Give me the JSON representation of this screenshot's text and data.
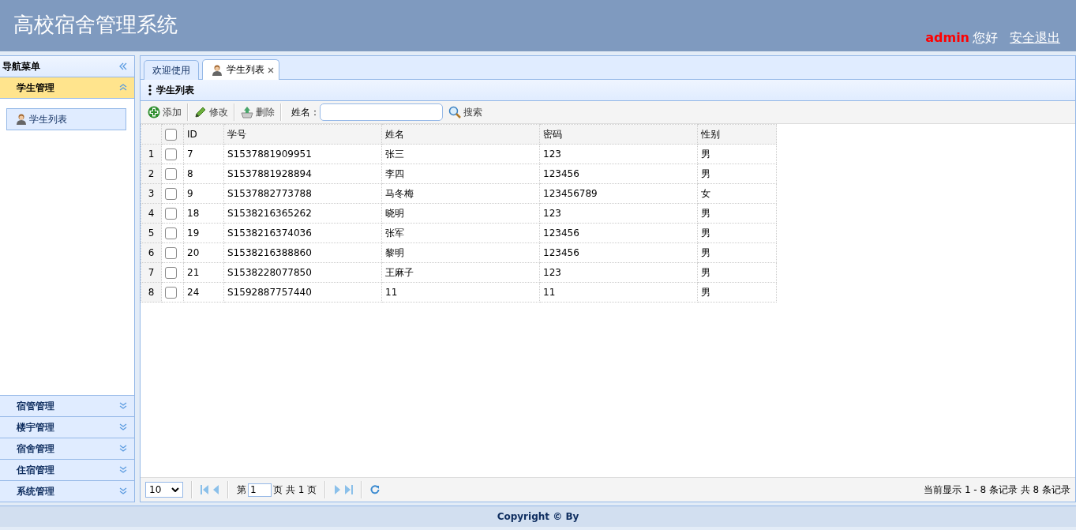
{
  "header": {
    "title": "高校宿舍管理系统",
    "user": "admin",
    "greeting": "您好",
    "logout": "安全退出"
  },
  "nav": {
    "title": "导航菜单",
    "sections": [
      {
        "label": "学生管理",
        "expanded": true,
        "items": [
          {
            "label": "学生列表",
            "selected": true
          }
        ]
      },
      {
        "label": "宿管管理",
        "expanded": false
      },
      {
        "label": "楼宇管理",
        "expanded": false
      },
      {
        "label": "宿舍管理",
        "expanded": false
      },
      {
        "label": "住宿管理",
        "expanded": false
      },
      {
        "label": "系统管理",
        "expanded": false
      }
    ]
  },
  "tabs": [
    {
      "label": "欢迎使用",
      "selected": false,
      "closable": false,
      "icon": false
    },
    {
      "label": "学生列表",
      "selected": true,
      "closable": true,
      "icon": true
    }
  ],
  "panel": {
    "title": "学生列表"
  },
  "toolbar": {
    "buttons": [
      {
        "kind": "add",
        "label": "添加"
      },
      {
        "kind": "edit",
        "label": "修改"
      },
      {
        "kind": "delete",
        "label": "删除"
      }
    ],
    "search_label": "姓名：",
    "search_button": "搜索"
  },
  "table": {
    "select_all_checked": false,
    "columns": [
      "ID",
      "学号",
      "姓名",
      "密码",
      "性别"
    ],
    "rows": [
      {
        "index": "1",
        "checked": false,
        "cells": [
          "7",
          "S1537881909951",
          "张三",
          "123",
          "男"
        ]
      },
      {
        "index": "2",
        "checked": false,
        "cells": [
          "8",
          "S1537881928894",
          "李四",
          "123456",
          "男"
        ]
      },
      {
        "index": "3",
        "checked": false,
        "cells": [
          "9",
          "S1537882773788",
          "马冬梅",
          "123456789",
          "女"
        ]
      },
      {
        "index": "4",
        "checked": false,
        "cells": [
          "18",
          "S1538216365262",
          "晓明",
          "123",
          "男"
        ]
      },
      {
        "index": "5",
        "checked": false,
        "cells": [
          "19",
          "S1538216374036",
          "张军",
          "123456",
          "男"
        ]
      },
      {
        "index": "6",
        "checked": false,
        "cells": [
          "20",
          "S1538216388860",
          "黎明",
          "123456",
          "男"
        ]
      },
      {
        "index": "7",
        "checked": false,
        "cells": [
          "21",
          "S1538228077850",
          "王麻子",
          "123",
          "男"
        ]
      },
      {
        "index": "8",
        "checked": false,
        "cells": [
          "24",
          "S1592887757440",
          "11",
          "11",
          "男"
        ]
      }
    ]
  },
  "pager": {
    "page_size": "10",
    "page_prefix": "第",
    "page": "1",
    "page_suffix": "页 共 1 页",
    "info": "当前显示 1 - 8 条记录 共 8 条记录"
  },
  "footer": {
    "text": "Copyright © By"
  }
}
